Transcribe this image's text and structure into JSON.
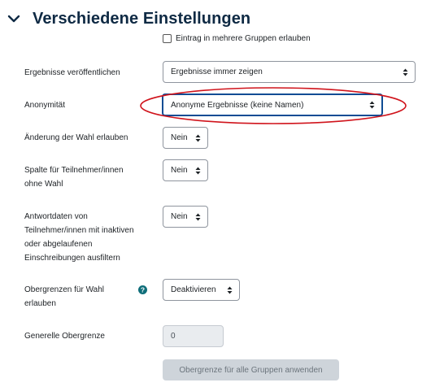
{
  "section": {
    "title": "Verschiedene Einstellungen"
  },
  "multi_group_checkbox": {
    "label": "Eintrag in mehrere Gruppen erlauben",
    "checked": false
  },
  "fields": {
    "publish_results": {
      "label": "Ergebnisse veröffentlichen",
      "value": "Ergebnisse immer zeigen"
    },
    "anonymity": {
      "label": "Anonymität",
      "value": "Anonyme Ergebnisse (keine Namen)"
    },
    "allow_change": {
      "label": "Änderung der Wahl erlauben",
      "value": "Nein"
    },
    "column_no_choice": {
      "label_line1": "Spalte für Teilnehmer/innen",
      "label_line2": "ohne Wahl",
      "value": "Nein"
    },
    "filter_inactive": {
      "label_line1": "Antwortdaten von",
      "label_line2": "Teilnehmer/innen mit inaktiven",
      "label_line3": "oder abgelaufenen",
      "label_line4": "Einschreibungen ausfiltern",
      "value": "Nein"
    },
    "limits": {
      "label_line1": "Obergrenzen für Wahl",
      "label_line2": "erlauben",
      "value": "Deaktivieren"
    },
    "general_limit": {
      "label": "Generelle Obergrenze",
      "value": "0"
    }
  },
  "apply_button": {
    "label": "Obergrenze für alle Gruppen anwenden"
  },
  "colors": {
    "title": "#0f2a44",
    "focus_border": "#0f4c94",
    "annotation": "#d0141c",
    "help_icon": "#0f6e7a"
  }
}
